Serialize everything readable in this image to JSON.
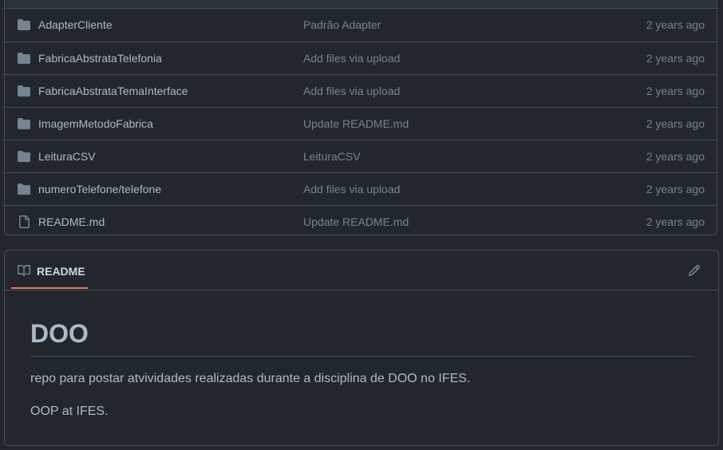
{
  "files": [
    {
      "type": "folder",
      "name": "AdapterCliente",
      "message": "Padrão Adapter",
      "age": "2 years ago"
    },
    {
      "type": "folder",
      "name": "FabricaAbstrataTelefonia",
      "message": "Add files via upload",
      "age": "2 years ago"
    },
    {
      "type": "folder",
      "name": "FabricaAbstrataTemaInterface",
      "message": "Add files via upload",
      "age": "2 years ago"
    },
    {
      "type": "folder",
      "name": "ImagemMetodoFabrica",
      "message": "Update README.md",
      "age": "2 years ago"
    },
    {
      "type": "folder",
      "name": "LeituraCSV",
      "message": "LeituraCSV",
      "age": "2 years ago"
    },
    {
      "type": "folder",
      "name": "numeroTelefone/telefone",
      "message": "Add files via upload",
      "age": "2 years ago"
    },
    {
      "type": "file",
      "name": "README.md",
      "message": "Update README.md",
      "age": "2 years ago"
    }
  ],
  "readme": {
    "tab_label": "README",
    "heading": "DOO",
    "paragraphs": [
      "repo para postar atvividades realizadas durante a disciplina de DOO no IFES.",
      "OOP at IFES."
    ]
  },
  "icons": {
    "folder": "folder-icon",
    "file": "file-icon",
    "book": "book-icon",
    "edit": "pencil-icon"
  },
  "colors": {
    "background": "#22272e",
    "border": "#444c56",
    "folder_icon": "#768390",
    "tab_underline": "#ec775c",
    "muted_text": "#768390",
    "text": "#adbac7"
  }
}
